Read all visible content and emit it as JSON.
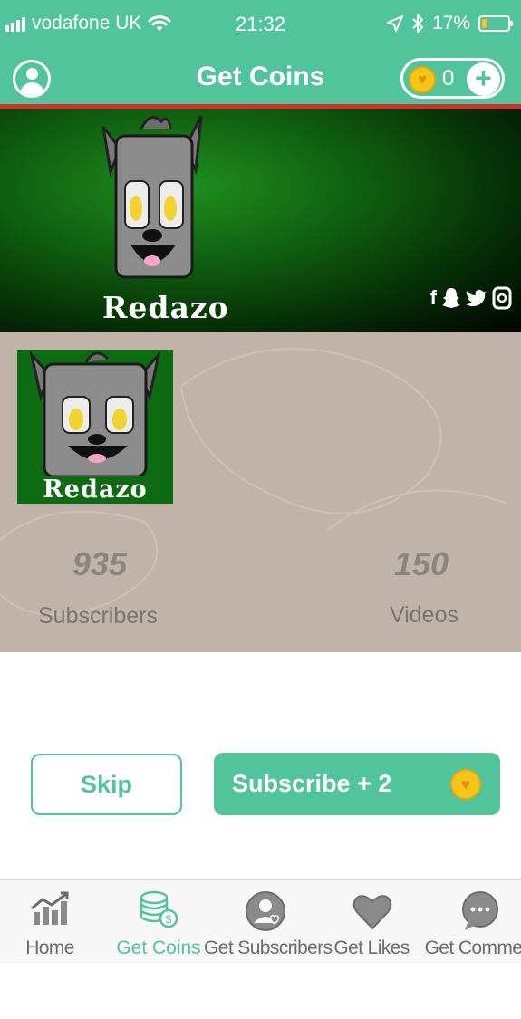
{
  "status_bar": {
    "carrier": "vodafone UK",
    "time": "21:32",
    "battery": "17%",
    "battery_level": 0.17
  },
  "header": {
    "title": "Get Coins",
    "coin_count": "0",
    "add_symbol": "+"
  },
  "banner": {
    "brand": "Redazo",
    "social_icons": [
      "facebook-icon",
      "snapchat-icon",
      "twitter-icon",
      "instagram-icon"
    ]
  },
  "channel": {
    "avatar_brand": "Redazo",
    "subscribers_value": "935",
    "subscribers_label": "Subscribers",
    "videos_value": "150",
    "videos_label": "Videos"
  },
  "actions": {
    "skip_label": "Skip",
    "subscribe_label": "Subscribe + 2"
  },
  "tabbar": {
    "tabs": [
      {
        "label": "Home",
        "icon": "chart-icon",
        "active": false
      },
      {
        "label": "Get Coins",
        "icon": "coins-icon",
        "active": true
      },
      {
        "label": "Get Subscribers",
        "icon": "user-heart-icon",
        "active": false
      },
      {
        "label": "Get Likes",
        "icon": "heart-icon",
        "active": false
      },
      {
        "label": "Get Commen",
        "icon": "comment-icon",
        "active": false
      }
    ]
  },
  "colors": {
    "accent": "#52c49b",
    "header_divider": "#d0322b",
    "channel_panel": "#c0b4aa",
    "coin": "#f5c518"
  }
}
